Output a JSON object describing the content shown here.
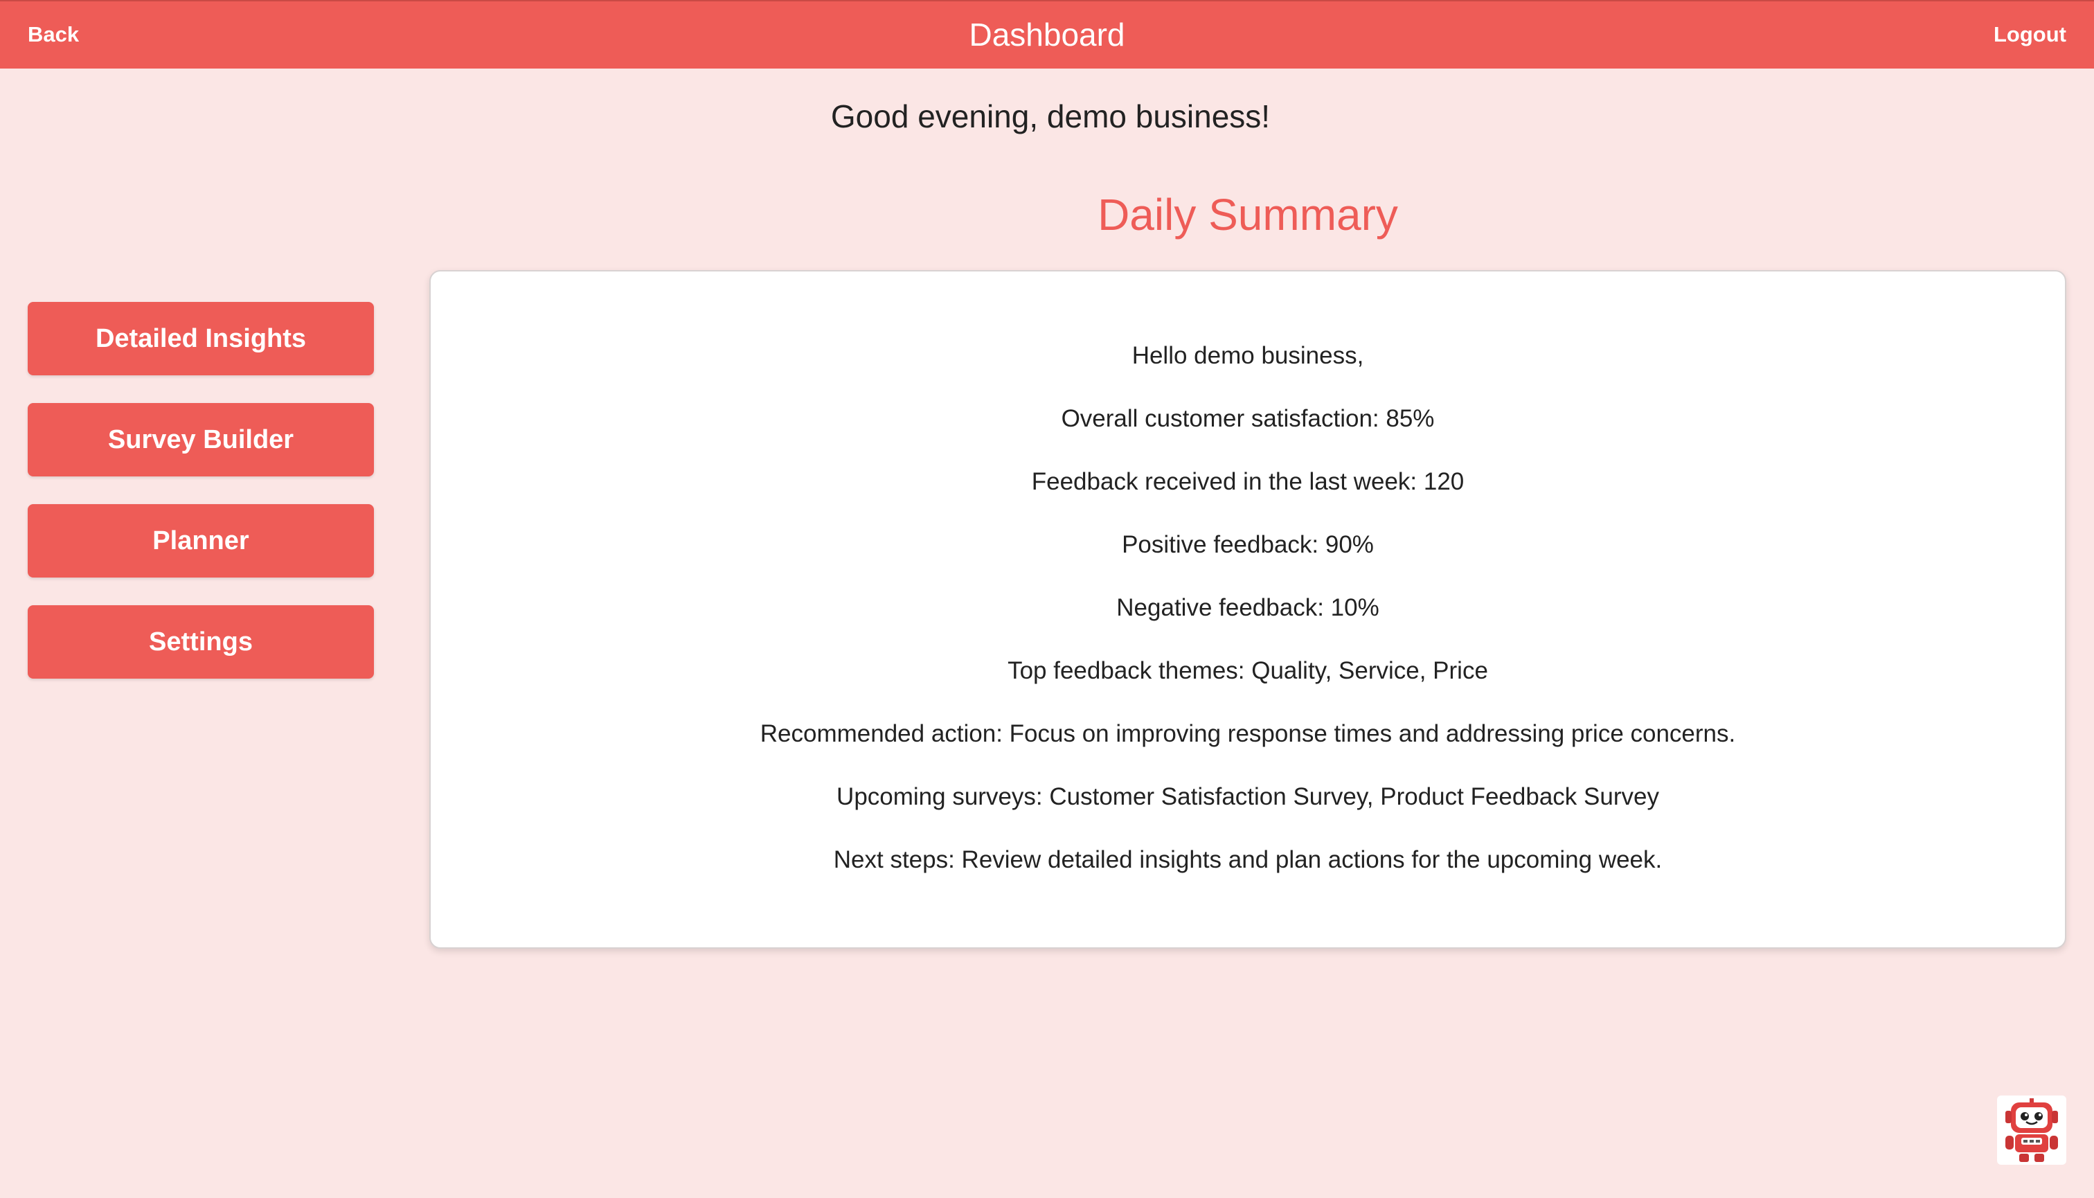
{
  "header": {
    "back_label": "Back",
    "title": "Dashboard",
    "logout_label": "Logout"
  },
  "greeting": "Good evening, demo business!",
  "summary": {
    "title": "Daily Summary",
    "lines": [
      "Hello demo business,",
      "Overall customer satisfaction: 85%",
      "Feedback received in the last week: 120",
      "Positive feedback: 90%",
      "Negative feedback: 10%",
      "Top feedback themes: Quality, Service, Price",
      "Recommended action: Focus on improving response times and addressing price concerns.",
      "Upcoming surveys: Customer Satisfaction Survey, Product Feedback Survey",
      "Next steps: Review detailed insights and plan actions for the upcoming week."
    ]
  },
  "sidebar": {
    "items": [
      {
        "label": "Detailed Insights"
      },
      {
        "label": "Survey Builder"
      },
      {
        "label": "Planner"
      },
      {
        "label": "Settings"
      }
    ]
  },
  "assistant": {
    "icon": "robot-icon"
  },
  "colors": {
    "accent": "#ee5c57",
    "background": "#fbe6e5"
  }
}
